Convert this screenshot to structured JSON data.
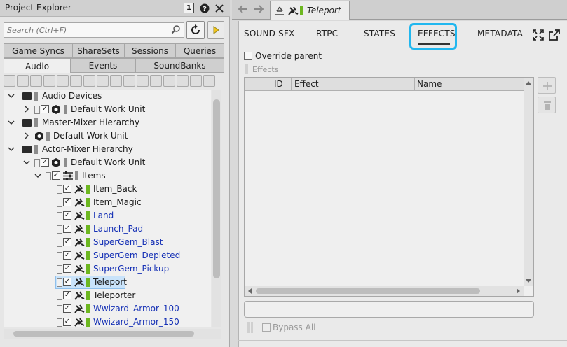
{
  "explorer": {
    "title": "Project Explorer",
    "badge": "1",
    "search_placeholder": "Search (Ctrl+F)",
    "tabs_row1": [
      "Game Syncs",
      "ShareSets",
      "Sessions",
      "Queries"
    ],
    "tabs_row2": [
      "Audio",
      "Events",
      "SoundBanks"
    ],
    "active_tab": "Audio",
    "tree": [
      {
        "label": "Audio Devices"
      },
      {
        "label": "Default Work Unit"
      },
      {
        "label": "Master-Mixer Hierarchy"
      },
      {
        "label": "Default Work Unit"
      },
      {
        "label": "Actor-Mixer Hierarchy"
      },
      {
        "label": "Default Work Unit"
      },
      {
        "label": "Items"
      },
      {
        "label": "Item_Back"
      },
      {
        "label": "Item_Magic"
      },
      {
        "label": "Land"
      },
      {
        "label": "Launch_Pad"
      },
      {
        "label": "SuperGem_Blast"
      },
      {
        "label": "SuperGem_Depleted"
      },
      {
        "label": "SuperGem_Pickup"
      },
      {
        "label": "Teleport"
      },
      {
        "label": "Teleporter"
      },
      {
        "label": "Wwizard_Armor_100"
      },
      {
        "label": "Wwizard_Armor_150"
      }
    ]
  },
  "editor": {
    "tab_title": "Teleport",
    "property_tabs": [
      "SOUND SFX",
      "RTPC",
      "STATES",
      "EFFECTS",
      "METADATA"
    ],
    "active_property_tab": "EFFECTS",
    "override_parent_label": "Override parent",
    "effects_label": "Effects",
    "table_columns": [
      "ID",
      "Effect",
      "Name"
    ],
    "bypass_all_label": "Bypass All"
  },
  "colors": {
    "accent_highlight": "#21b7ef",
    "link_blue": "#1530b5",
    "object_green": "#6db720",
    "selection": "#c9e3fa"
  }
}
